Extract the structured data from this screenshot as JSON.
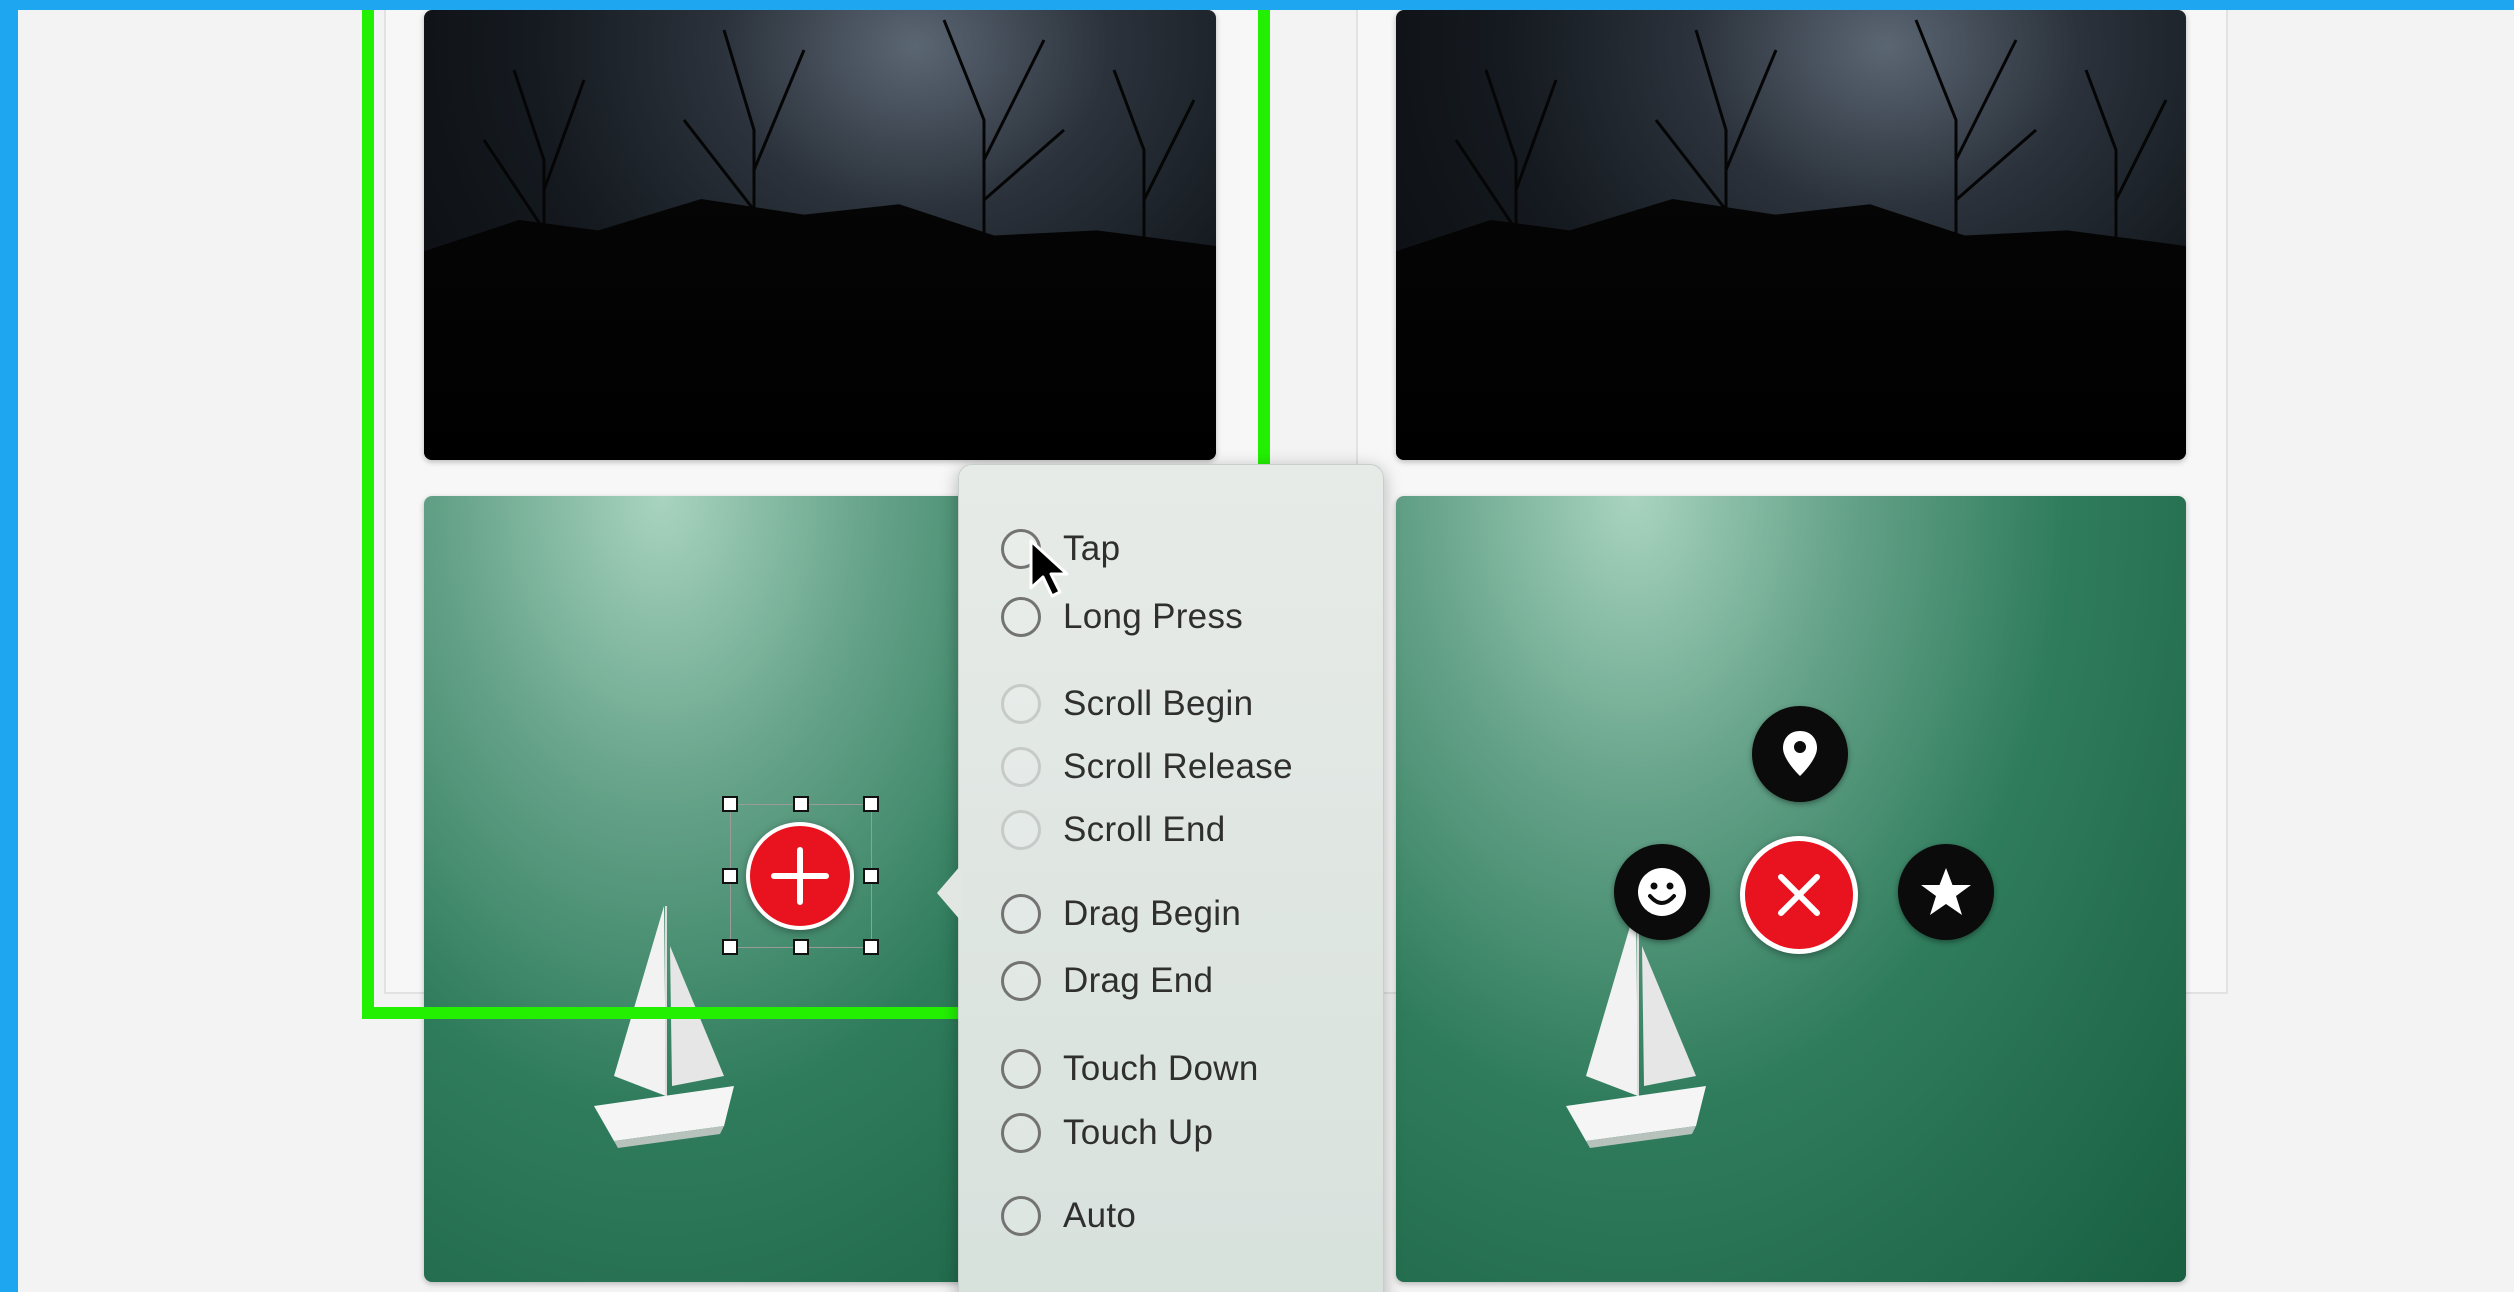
{
  "canvas": {
    "background": "#f3f3f3",
    "frame_border_color": "#1ea7f0",
    "selection_outline_color": "#22f000"
  },
  "photos": [
    {
      "name": "night-forest-photo",
      "scene": "starry night sky over silhouetted trees"
    },
    {
      "name": "night-forest-photo",
      "scene": "starry night sky over silhouetted trees"
    },
    {
      "name": "sailboat-sea-photo",
      "scene": "white sailboat on green sea"
    },
    {
      "name": "sailboat-sea-photo",
      "scene": "white sailboat on green sea"
    }
  ],
  "buttons": {
    "add": {
      "icon": "plus-icon",
      "color": "#e8131f"
    },
    "close": {
      "icon": "close-icon",
      "color": "#e8131f"
    },
    "menu_items": [
      {
        "icon": "location-pin-icon"
      },
      {
        "icon": "smiley-icon"
      },
      {
        "icon": "star-icon"
      }
    ]
  },
  "trigger_menu": {
    "options": [
      {
        "label": "Tap",
        "selected": false,
        "enabled": true
      },
      {
        "label": "Long Press",
        "selected": false,
        "enabled": true
      },
      {
        "label": "Scroll Begin",
        "selected": false,
        "enabled": false
      },
      {
        "label": "Scroll Release",
        "selected": false,
        "enabled": false
      },
      {
        "label": "Scroll End",
        "selected": false,
        "enabled": false
      },
      {
        "label": "Drag Begin",
        "selected": false,
        "enabled": true
      },
      {
        "label": "Drag End",
        "selected": false,
        "enabled": true
      },
      {
        "label": "Touch Down",
        "selected": false,
        "enabled": true
      },
      {
        "label": "Touch Up",
        "selected": false,
        "enabled": true
      },
      {
        "label": "Auto",
        "selected": false,
        "enabled": true
      }
    ]
  }
}
